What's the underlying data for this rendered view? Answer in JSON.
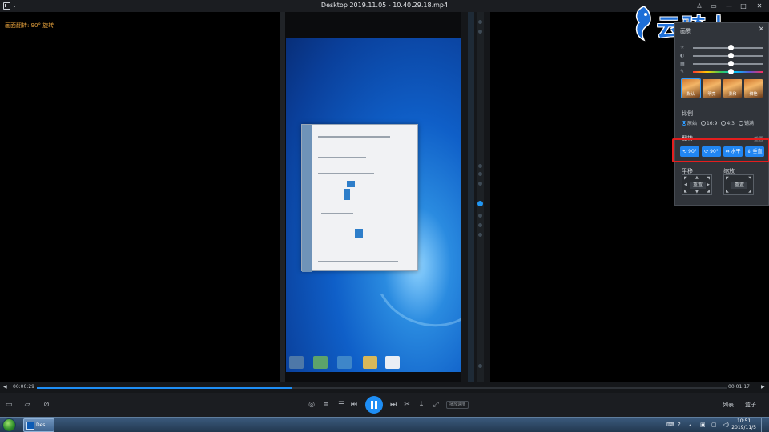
{
  "window": {
    "title": "Desktop 2019.11.05 - 10.40.29.18.mp4"
  },
  "osd": {
    "message": "画面翻转: 90° 旋转"
  },
  "watermark": {
    "text": "云骑士"
  },
  "settings_panel": {
    "title": "画质",
    "close": "✕",
    "filters": [
      {
        "label": "默认",
        "selected": true
      },
      {
        "label": "明亮",
        "selected": false
      },
      {
        "label": "柔和",
        "selected": false
      },
      {
        "label": "鲜艳",
        "selected": false
      }
    ],
    "ratio": {
      "heading": "比例",
      "options": [
        {
          "label": "原始",
          "selected": true
        },
        {
          "label": "16:9",
          "selected": false
        },
        {
          "label": "4:3",
          "selected": false
        },
        {
          "label": "铺满",
          "selected": false
        }
      ]
    },
    "rotate": {
      "heading": "翻转",
      "reset": "重置",
      "buttons": [
        "90°",
        "90°",
        "水平",
        "垂直"
      ]
    },
    "pan": {
      "heading": "平移",
      "center": "重置"
    },
    "zoom": {
      "heading": "缩放",
      "center": "重置"
    },
    "accent": "#2186f3"
  },
  "playback": {
    "elapsed": "00:00:29",
    "total": "00:01:17",
    "progress_fraction": 0.37,
    "speed_label": "播放速度",
    "list_label": "列表",
    "box_label": "盒子",
    "accent": "#1e8ef5"
  },
  "taskbar": {
    "app_label": "Des...",
    "time": "10:51",
    "date": "2019/11/5"
  }
}
